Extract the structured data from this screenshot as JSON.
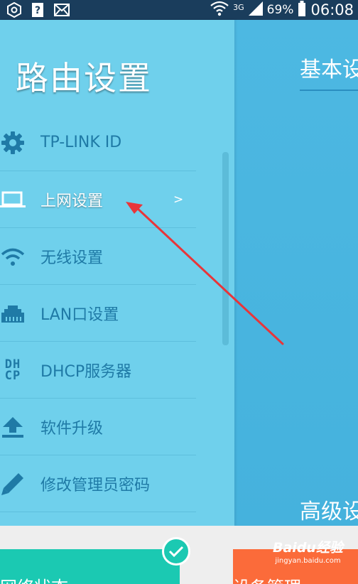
{
  "status_bar": {
    "network_type": "3G",
    "battery_percent": "69%",
    "time": "06:08",
    "icons": [
      "settings-hex-icon",
      "help-icon",
      "mail-icon",
      "wifi-icon",
      "signal-icon",
      "battery-icon"
    ]
  },
  "drawer": {
    "title": "路由设置",
    "menu": [
      {
        "id": "tplink-id",
        "label": "TP-LINK ID",
        "icon": "gear-icon",
        "active": false
      },
      {
        "id": "internet",
        "label": "上网设置",
        "icon": "laptop-icon",
        "active": true,
        "arrow": ">"
      },
      {
        "id": "wireless",
        "label": "无线设置",
        "icon": "wifi-icon",
        "active": false
      },
      {
        "id": "lan",
        "label": "LAN口设置",
        "icon": "ethernet-port-icon",
        "active": false
      },
      {
        "id": "dhcp",
        "label": "DHCP服务器",
        "icon": "dhcp-icon",
        "icon_text_line1": "DH",
        "icon_text_line2": "CP",
        "active": false
      },
      {
        "id": "upgrade",
        "label": "软件升级",
        "icon": "upload-icon",
        "active": false
      },
      {
        "id": "password",
        "label": "修改管理员密码",
        "icon": "pencil-icon",
        "active": false
      }
    ]
  },
  "content": {
    "section_basic": "基本设",
    "section_advanced": "高级设"
  },
  "bottom": {
    "network_status_label": "网络状态",
    "device_manage_label": "设备管理"
  },
  "watermark": {
    "brand": "Baidu经验",
    "sub": "jingyan.baidu.com"
  },
  "colors": {
    "drawer_bg": "#6fd0ec",
    "content_bg": "#4ab6e0",
    "menu_text": "#1f7aa6",
    "status_card": "#1bc9b2",
    "device_card": "#fb6b3a",
    "annotation_arrow": "#e8353a"
  }
}
